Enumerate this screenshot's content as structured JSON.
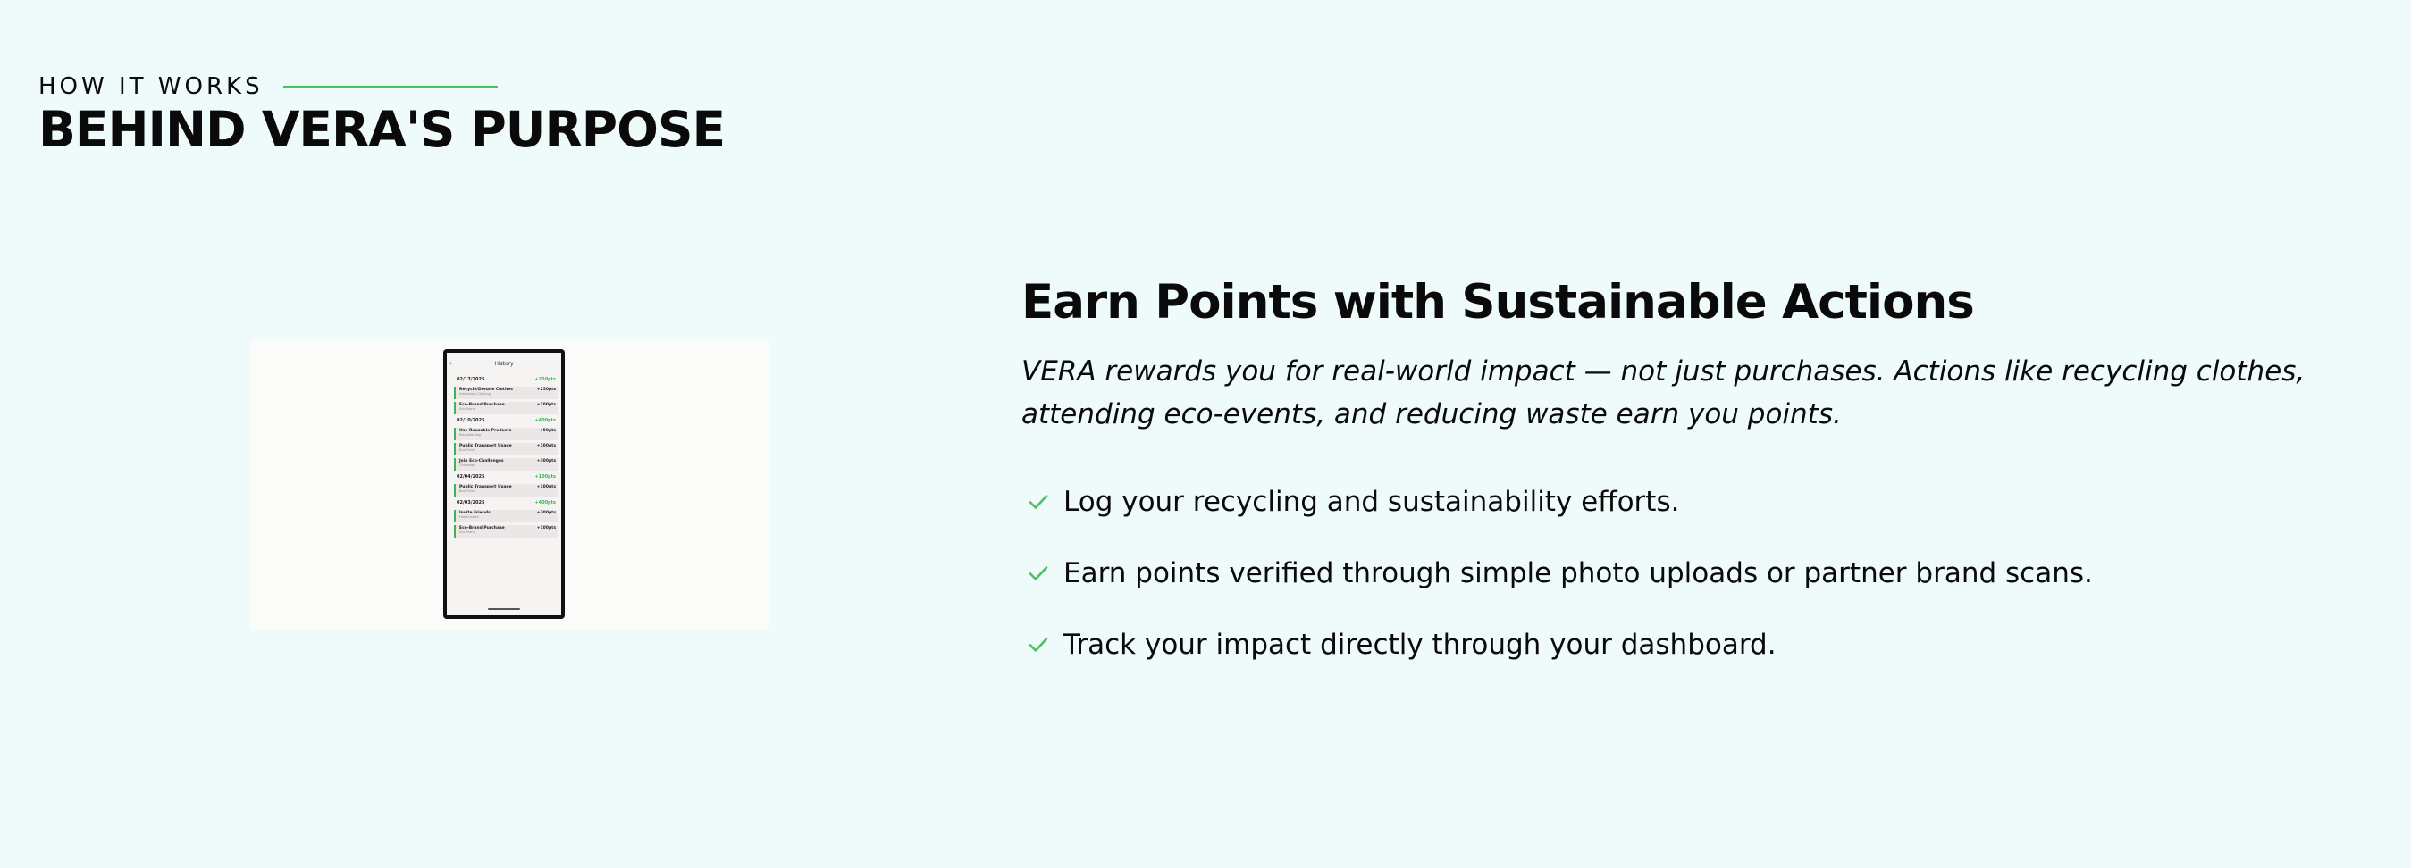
{
  "header": {
    "eyebrow": "HOW IT WORKS",
    "title": "BEHIND VERA'S PURPOSE"
  },
  "screenshot": {
    "screen_title": "History",
    "groups": [
      {
        "date": "02/17/2025",
        "total": "+250pts",
        "items": [
          {
            "label": "Recycle/Donate Clothes",
            "sub": "Indigenous Clothing",
            "points": "+250pts"
          },
          {
            "label": "Eco-Brand Purchase",
            "sub": "Eco Brand",
            "points": "+100pts"
          }
        ]
      },
      {
        "date": "02/10/2025",
        "total": "+400pts",
        "items": [
          {
            "label": "Use Reusable Products",
            "sub": "Reusable Bag",
            "points": "+50pts"
          },
          {
            "label": "Public Transport Usage",
            "sub": "Bus Ticket",
            "points": "+100pts"
          },
          {
            "label": "Join Eco-Challenges",
            "sub": "Challenge",
            "points": "+300pts"
          }
        ]
      },
      {
        "date": "02/04/2025",
        "total": "+100pts",
        "items": [
          {
            "label": "Public Transport Usage",
            "sub": "Bus Ticket",
            "points": "+100pts"
          }
        ]
      },
      {
        "date": "02/03/2025",
        "total": "+400pts",
        "items": [
          {
            "label": "Invite Friends",
            "sub": "Friend Invite",
            "points": "+300pts"
          },
          {
            "label": "Eco-Brand Purchase",
            "sub": "Eco Brand",
            "points": "+100pts"
          }
        ]
      }
    ]
  },
  "feature": {
    "title": "Earn Points with Sustainable Actions",
    "lead": "VERA rewards you for real-world impact — not just purchases. Actions like recycling clothes, attending eco-events, and reducing waste earn you points.",
    "benefits": [
      "Log your recycling and sustainability efforts.",
      "Earn points verified through simple photo uploads or partner brand scans.",
      "Track your impact directly through your dashboard."
    ]
  },
  "colors": {
    "background": "#effbfb",
    "accent": "#4cc15f"
  },
  "icons": {
    "benefit_marker": "check-icon",
    "back": "chevron-left-icon"
  }
}
